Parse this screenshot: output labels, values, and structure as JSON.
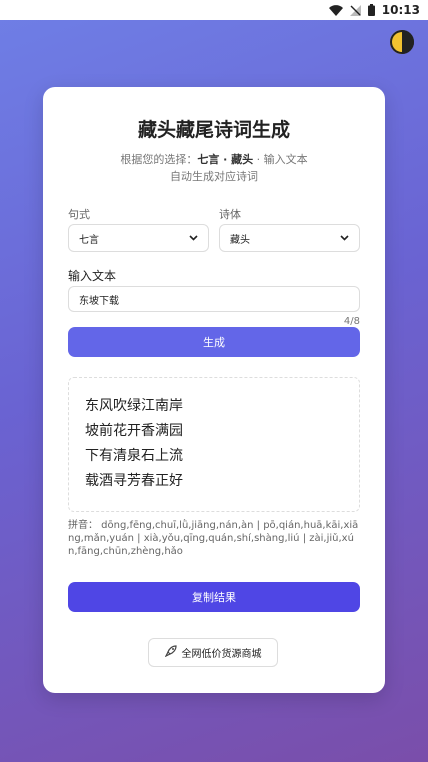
{
  "status_bar": {
    "time": "10:13"
  },
  "card": {
    "title": "藏头藏尾诗词生成",
    "subtitle_prefix": "根据您的选择：",
    "subtitle_selection": "七言 · 藏头",
    "subtitle_suffix": " · 输入文本",
    "subtitle_line2": "自动生成对应诗词",
    "form": {
      "sentence_label": "句式",
      "sentence_value": "七言",
      "style_label": "诗体",
      "style_value": "藏头",
      "input_label": "输入文本",
      "input_value": "东坡下载",
      "counter": "4/8",
      "generate_label": "生成"
    },
    "poem_lines": [
      "东风吹绿江南岸",
      "坡前花开香满园",
      "下有清泉石上流",
      "载酒寻芳春正好"
    ],
    "pinyin": "拼音： dōng,fēng,chuī,lǜ,jiāng,nán,àn | pō,qián,huā,kāi,xiāng,mǎn,yuán | xià,yǒu,qīng,quán,shí,shàng,liú | zài,jiǔ,xún,fāng,chūn,zhèng,hǎo",
    "copy_label": "复制结果",
    "mall_label": "全网低价货源商城"
  },
  "colors": {
    "generate_button": "#6366e8",
    "copy_button": "#4f46e5",
    "theme_toggle": "#f2c230"
  }
}
